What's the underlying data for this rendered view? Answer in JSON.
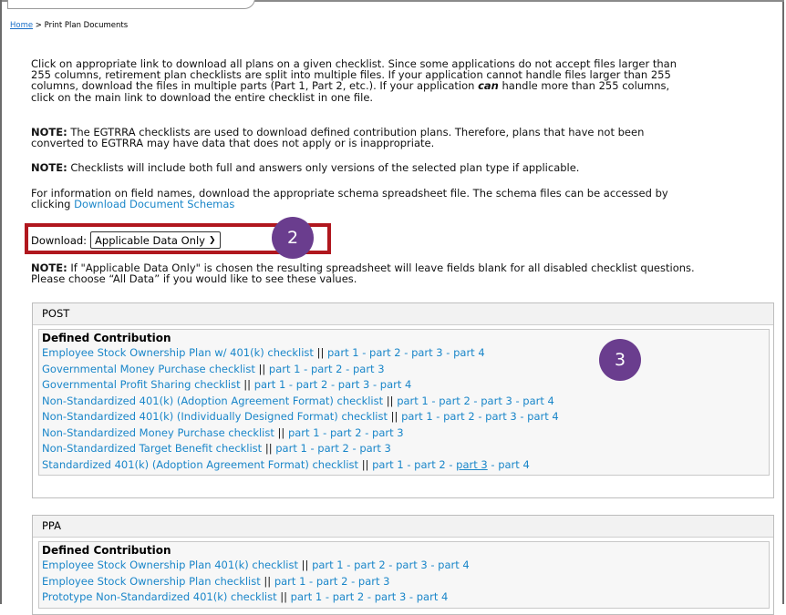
{
  "breadcrumb": {
    "home": "Home",
    "separator": " > ",
    "current": "Print Plan Documents"
  },
  "intro": {
    "lines": [
      "Click on appropriate link to download all plans on a given checklist. Since some applications do not accept files larger than",
      "255 columns, retirement plan checklists are split into multiple files. If your application cannot handle files larger than 255",
      "columns, download the files in multiple parts (Part 1, Part 2, etc.). If your application",
      "can",
      "handle more than 255 columns,",
      "click on the main link to download the entire checklist in one file."
    ]
  },
  "note1": {
    "label": "NOTE:",
    "line1": " The EGTRRA checklists are used to download defined contribution plans. Therefore, plans that have not been",
    "line2": "converted to EGTRRA may have data that does not apply or is inappropriate."
  },
  "note2": {
    "label": "NOTE:",
    "text": " Checklists will include both full and answers only versions of the selected plan type if applicable."
  },
  "schema": {
    "line1": "For information on field names, download the appropriate schema spreadsheet file. The schema files can be accessed by",
    "line2_prefix": "clicking ",
    "link": "Download Document Schemas"
  },
  "download": {
    "label": "Download:",
    "selected": "Applicable Data Only"
  },
  "callouts": {
    "c2": "2",
    "c3": "3"
  },
  "note3": {
    "label": "NOTE:",
    "line1_a": " If \"Applicable Data Only\" is chosen ",
    "line1_b": "the resulting spreadsheet will leave fields blank for all disabled checklist questions.",
    "line2": "Please choose “All Data” if you would like to see these values."
  },
  "post": {
    "header": "POST",
    "group": "Defined Contribution",
    "items": [
      {
        "name": "Employee Stock Ownership Plan w/ 401(k) checklist",
        "parts": [
          "part 1",
          "part 2",
          "part 3",
          "part 4"
        ]
      },
      {
        "name": "Governmental Money Purchase checklist",
        "parts": [
          "part 1",
          "part 2",
          "part 3"
        ]
      },
      {
        "name": "Governmental Profit Sharing checklist",
        "parts": [
          "part 1",
          "part 2",
          "part 3",
          "part 4"
        ]
      },
      {
        "name": "Non-Standardized 401(k) (Adoption Agreement Format) checklist",
        "parts": [
          "part 1",
          "part 2",
          "part 3",
          "part 4"
        ]
      },
      {
        "name": "Non-Standardized 401(k) (Individually Designed Format) checklist",
        "parts": [
          "part 1",
          "part 2",
          "part 3",
          "part 4"
        ]
      },
      {
        "name": "Non-Standardized Money Purchase checklist",
        "parts": [
          "part 1",
          "part 2",
          "part 3"
        ]
      },
      {
        "name": "Non-Standardized Target Benefit checklist",
        "parts": [
          "part 1",
          "part 2",
          "part 3"
        ]
      },
      {
        "name": "Standardized 401(k) (Adoption Agreement Format) checklist",
        "parts": [
          "part 1",
          "part 2",
          "part 3",
          "part 4"
        ]
      }
    ]
  },
  "ppa": {
    "header": "PPA",
    "group": "Defined Contribution",
    "items": [
      {
        "name": "Employee Stock Ownership Plan 401(k) checklist",
        "parts": [
          "part 1",
          "part 2",
          "part 3",
          "part 4"
        ]
      },
      {
        "name": "Employee Stock Ownership Plan checklist",
        "parts": [
          "part 1",
          "part 2",
          "part 3"
        ]
      },
      {
        "name": "Prototype Non-Standardized 401(k) checklist",
        "parts": [
          "part 1",
          "part 2",
          "part 3",
          "part 4"
        ]
      }
    ]
  },
  "separator": " || ",
  "dash": " - ",
  "colors": {
    "link": "#1a86c9",
    "callout": "#6a3d8e",
    "highlight_box": "#b0171e"
  }
}
